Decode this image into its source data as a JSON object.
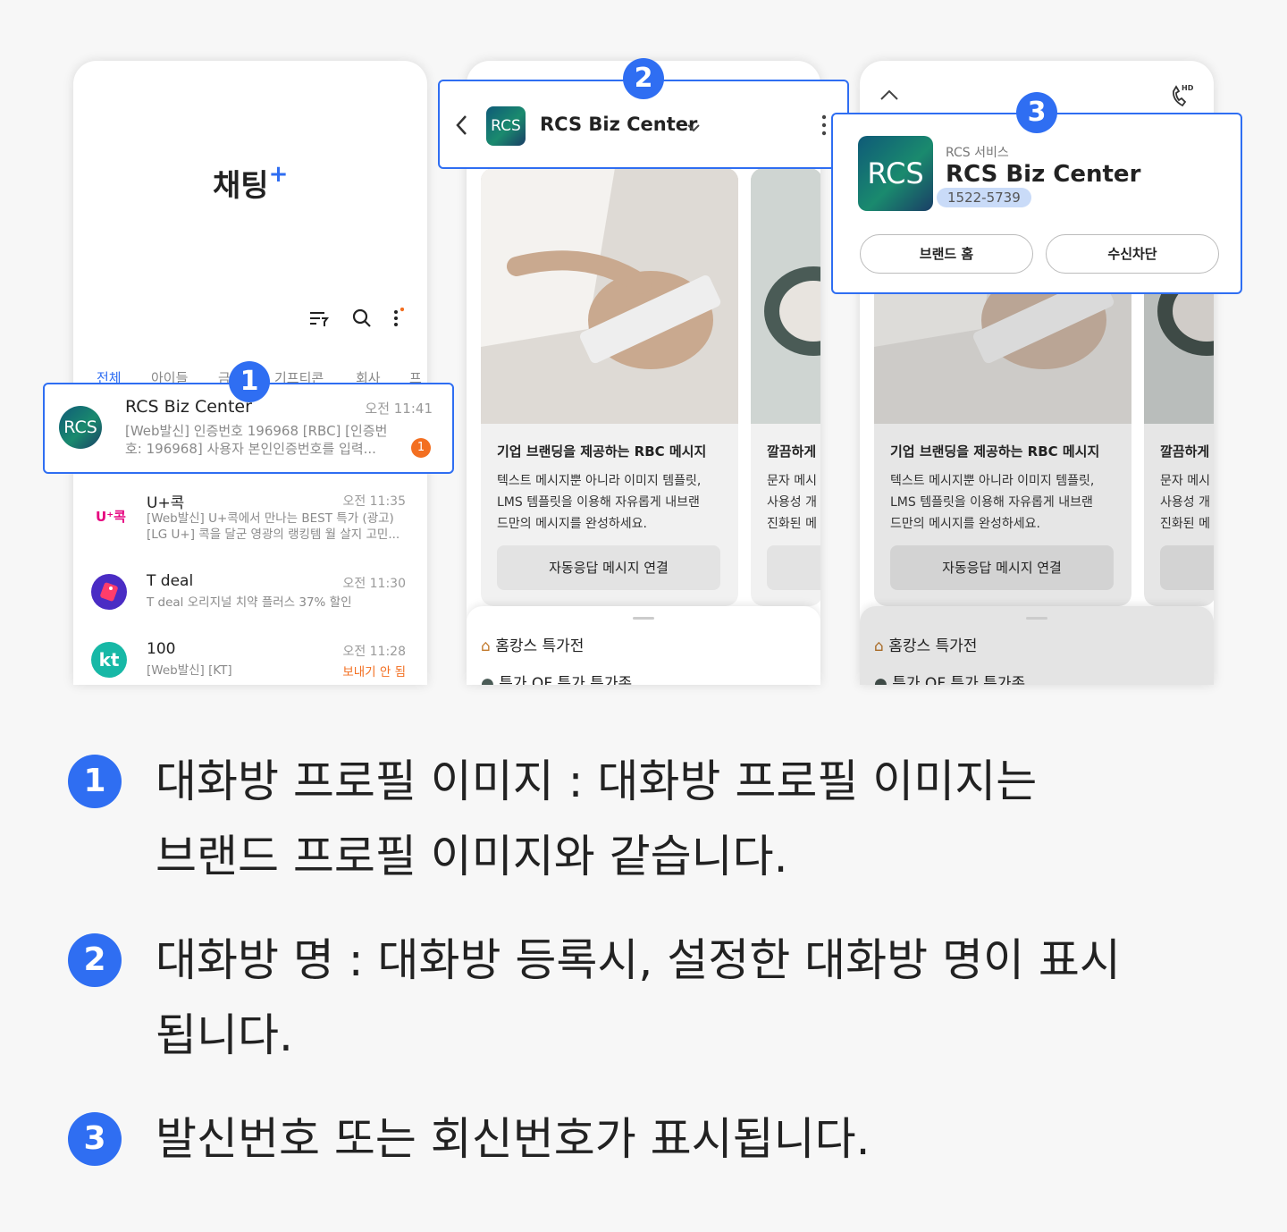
{
  "phone1": {
    "title": "채팅",
    "title_plus": "+",
    "tabs": [
      "전체",
      "아이들",
      "금",
      "기프티콘",
      "회사",
      "프"
    ],
    "chats": [
      {
        "avatar": "RCS",
        "name": "RCS Biz Center",
        "time": "오전 11:41",
        "preview1": "[Web발신] 인증번호 196968 [RBC] [인증번",
        "preview2": "호: 196968] 사용자 본인인증번호를 입력...",
        "unread": "1"
      },
      {
        "avatar": "U⁺콕",
        "name": "U+콕",
        "time": "오전 11:35",
        "preview1": "[Web발신] U+콕에서 만나는 BEST 특가 (광고)",
        "preview2": "[LG U+] 콕을 달군 영광의 랭킹템 월 살지 고민..."
      },
      {
        "avatar": "",
        "name": "T deal",
        "time": "오전 11:30",
        "preview1": "T deal 오리지널 치약 플러스 37% 할인"
      },
      {
        "avatar": "kt",
        "name": "100",
        "time": "오전 11:28",
        "preview1": "[Web발신] [KT]",
        "status": "보내기 안 됨"
      }
    ]
  },
  "phone2": {
    "logo": "RCS",
    "room_name": "RCS Biz Center",
    "cards": [
      {
        "title": "기업 브랜딩을 제공하는 RBC 메시지",
        "body1": "텍스트 메시지뿐 아니라 이미지 템플릿,",
        "body2": "LMS 템플릿을 이용해 자유롭게 내브랜",
        "body3": "드만의 메시지를 완성하세요.",
        "button": "자동응답 메시지 연결"
      },
      {
        "title": "깔끔하게",
        "body1": "문자 메시",
        "body2": "사용성 개",
        "body3": "진화된 메"
      }
    ],
    "sheet_item1": "홈캉스 특가전",
    "sheet_item2": "특가 OF 특가 특가존"
  },
  "phone3": {
    "service_label": "RCS 서비스",
    "logo": "RCS",
    "brand_name": "RCS Biz Center",
    "number": "1522-5739",
    "brand_home_button": "브랜드 홈",
    "block_button": "수신차단",
    "hd_label": "HD"
  },
  "badges": [
    "1",
    "2",
    "3"
  ],
  "descriptions": [
    {
      "num": "1",
      "line1": "대화방 프로필 이미지 : 대화방 프로필 이미지는",
      "line2": "브랜드 프로필 이미지와 같습니다."
    },
    {
      "num": "2",
      "line1": "대화방 명 : 대화방 등록시, 설정한 대화방 명이 표시",
      "line2": "됩니다."
    },
    {
      "num": "3",
      "line1": "발신번호 또는 회신번호가 표시됩니다."
    }
  ],
  "colors": {
    "accent": "#2f6ef2",
    "orange": "#f36f21",
    "background": "#f7f7f7"
  }
}
